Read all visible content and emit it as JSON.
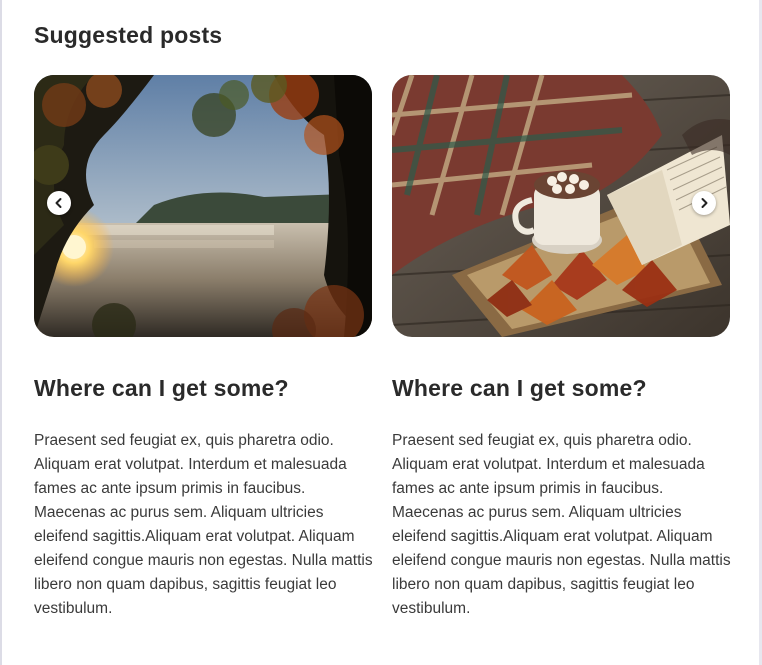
{
  "section": {
    "title": "Suggested posts"
  },
  "carousel": {
    "prev_icon": "chevron-left-icon",
    "next_icon": "chevron-right-icon"
  },
  "posts": [
    {
      "title": "Where can I get some?",
      "body": "Praesent sed feugiat ex, quis pharetra odio. Aliquam erat volutpat. Interdum et malesuada fames ac ante ipsum primis in faucibus. Maecenas ac purus sem. Aliquam ultricies eleifend sagittis.Aliquam erat volutpat. Aliquam eleifend congue mauris non egestas. Nulla mattis libero non quam dapibus, sagittis feugiat leo vestibulum."
    },
    {
      "title": "Where can I get some?",
      "body": "Praesent sed feugiat ex, quis pharetra odio. Aliquam erat volutpat. Interdum et malesuada fames ac ante ipsum primis in faucibus. Maecenas ac purus sem. Aliquam ultricies eleifend sagittis.Aliquam erat volutpat. Aliquam eleifend congue mauris non egestas. Nulla mattis libero non quam dapibus, sagittis feugiat leo vestibulum."
    }
  ]
}
